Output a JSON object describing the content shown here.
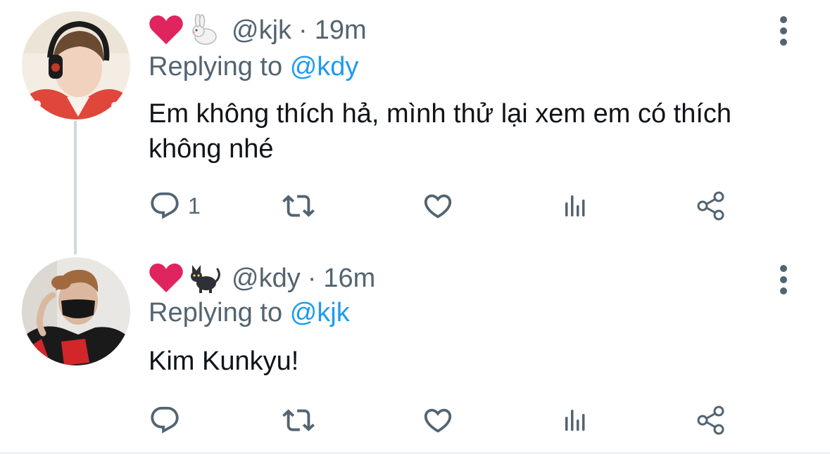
{
  "colors": {
    "text": "#0f1419",
    "secondary": "#536471",
    "link": "#1d9bf0",
    "thread_line": "#cfd9de",
    "heart_emoji": "#e0245e"
  },
  "tweets": [
    {
      "emojis": [
        "red-heart",
        "rabbit"
      ],
      "handle": "@kjk",
      "separator": "·",
      "time": "19m",
      "replying_prefix": "Replying to",
      "replying_to": "@kdy",
      "text": "Em không thích hả, mình thử lại xem em có thích không nhé",
      "reply_count": "1"
    },
    {
      "emojis": [
        "red-heart",
        "black-cat"
      ],
      "handle": "@kdy",
      "separator": "·",
      "time": "16m",
      "replying_prefix": "Replying to",
      "replying_to": "@kjk",
      "text": "Kim Kunkyu!",
      "reply_count": ""
    }
  ]
}
